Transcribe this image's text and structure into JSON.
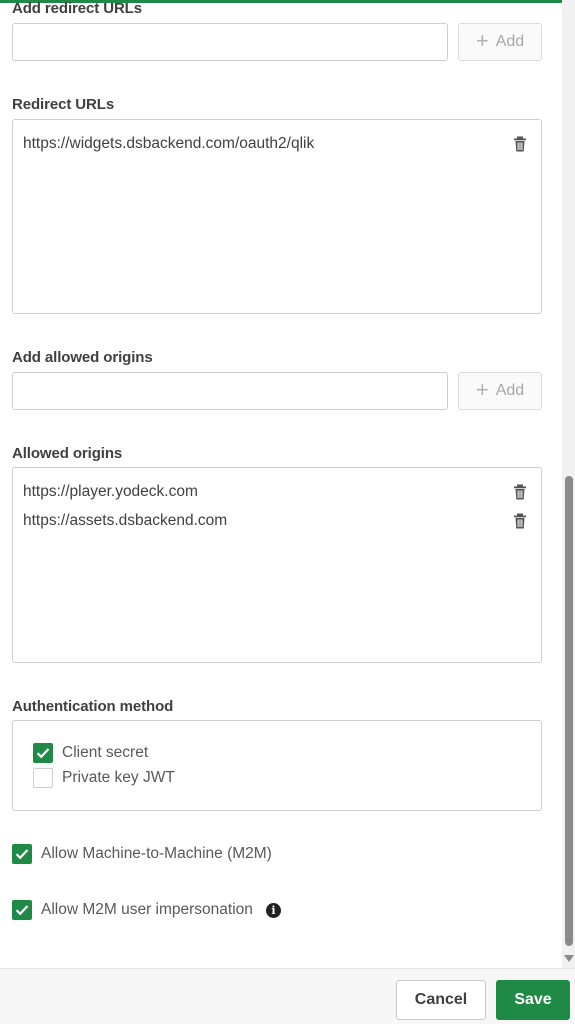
{
  "redirect": {
    "add_label": "Add redirect URLs",
    "add_button": "Add",
    "list_label": "Redirect URLs",
    "urls": [
      "https://widgets.dsbackend.com/oauth2/qlik"
    ]
  },
  "origins": {
    "add_label": "Add allowed origins",
    "add_button": "Add",
    "list_label": "Allowed origins",
    "items": [
      "https://player.yodeck.com",
      "https://assets.dsbackend.com"
    ]
  },
  "auth": {
    "label": "Authentication method",
    "client_secret": {
      "label": "Client secret",
      "checked": true
    },
    "private_key_jwt": {
      "label": "Private key JWT",
      "checked": false
    }
  },
  "m2m": {
    "label": "Allow Machine-to-Machine (M2M)",
    "checked": true
  },
  "impersonation": {
    "label": "Allow M2M user impersonation",
    "checked": true
  },
  "footer": {
    "cancel": "Cancel",
    "save": "Save"
  },
  "colors": {
    "accent": "#1f8a46",
    "text": "#404040",
    "border": "#cfcfcf"
  }
}
